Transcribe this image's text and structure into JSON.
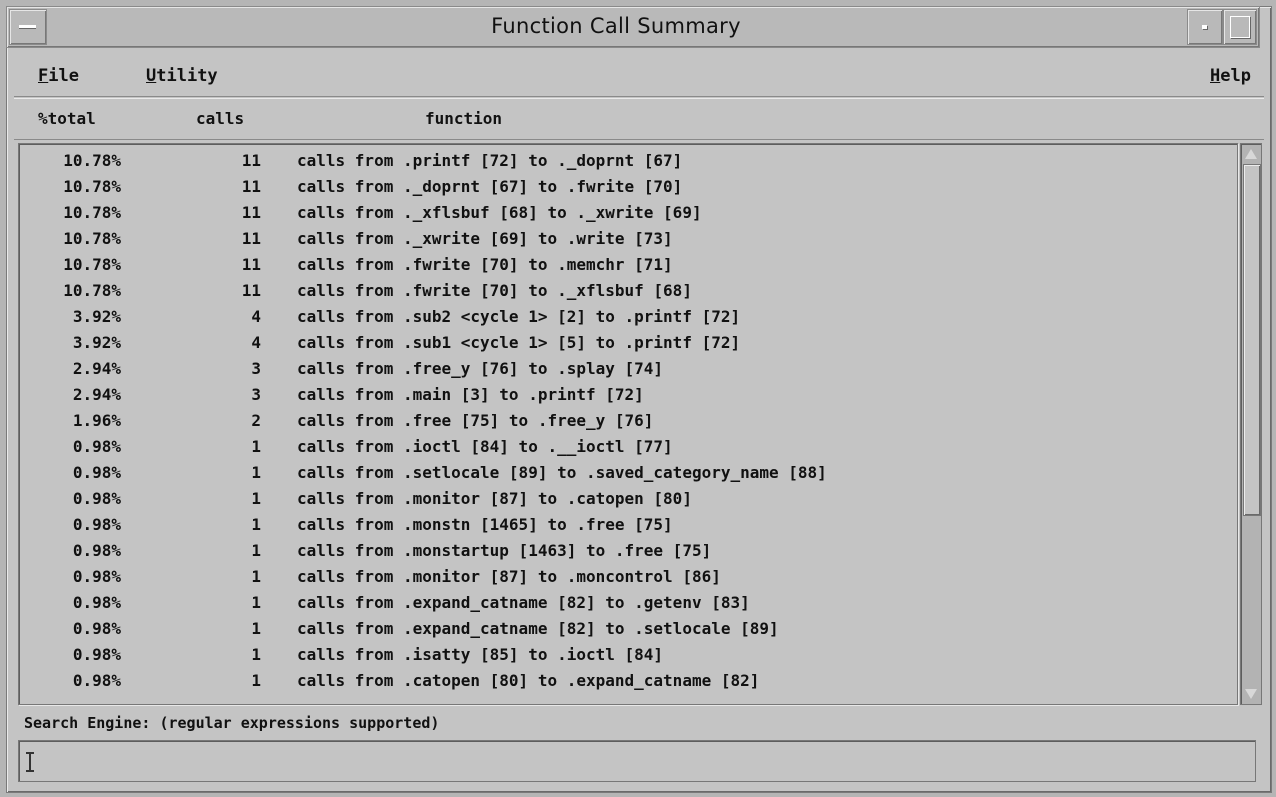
{
  "window": {
    "title": "Function Call Summary"
  },
  "menu": {
    "file": "File",
    "utility": "Utility",
    "help": "Help"
  },
  "columns": {
    "total": "%total",
    "calls": "calls",
    "function": "function"
  },
  "rows": [
    {
      "pct": "10.78%",
      "calls": "11",
      "fn": "calls from .printf [72] to ._doprnt [67]"
    },
    {
      "pct": "10.78%",
      "calls": "11",
      "fn": "calls from ._doprnt [67] to .fwrite [70]"
    },
    {
      "pct": "10.78%",
      "calls": "11",
      "fn": "calls from ._xflsbuf [68] to ._xwrite [69]"
    },
    {
      "pct": "10.78%",
      "calls": "11",
      "fn": "calls from ._xwrite [69] to .write [73]"
    },
    {
      "pct": "10.78%",
      "calls": "11",
      "fn": "calls from .fwrite [70] to .memchr [71]"
    },
    {
      "pct": "10.78%",
      "calls": "11",
      "fn": "calls from .fwrite [70] to ._xflsbuf [68]"
    },
    {
      "pct": "3.92%",
      "calls": "4",
      "fn": "calls from .sub2 <cycle 1> [2] to .printf [72]"
    },
    {
      "pct": "3.92%",
      "calls": "4",
      "fn": "calls from .sub1 <cycle 1> [5] to .printf [72]"
    },
    {
      "pct": "2.94%",
      "calls": "3",
      "fn": "calls from .free_y [76] to .splay [74]"
    },
    {
      "pct": "2.94%",
      "calls": "3",
      "fn": "calls from .main [3] to .printf [72]"
    },
    {
      "pct": "1.96%",
      "calls": "2",
      "fn": "calls from .free [75] to .free_y [76]"
    },
    {
      "pct": "0.98%",
      "calls": "1",
      "fn": "calls from .ioctl [84] to .__ioctl [77]"
    },
    {
      "pct": "0.98%",
      "calls": "1",
      "fn": "calls from .setlocale [89] to .saved_category_name [88]"
    },
    {
      "pct": "0.98%",
      "calls": "1",
      "fn": "calls from .monitor [87] to .catopen [80]"
    },
    {
      "pct": "0.98%",
      "calls": "1",
      "fn": "calls from .monstn [1465] to .free [75]"
    },
    {
      "pct": "0.98%",
      "calls": "1",
      "fn": "calls from .monstartup [1463] to .free [75]"
    },
    {
      "pct": "0.98%",
      "calls": "1",
      "fn": "calls from .monitor [87] to .moncontrol [86]"
    },
    {
      "pct": "0.98%",
      "calls": "1",
      "fn": "calls from .expand_catname [82] to .getenv [83]"
    },
    {
      "pct": "0.98%",
      "calls": "1",
      "fn": "calls from .expand_catname [82] to .setlocale [89]"
    },
    {
      "pct": "0.98%",
      "calls": "1",
      "fn": "calls from .isatty [85] to .ioctl [84]"
    },
    {
      "pct": "0.98%",
      "calls": "1",
      "fn": "calls from .catopen [80] to .expand_catname [82]"
    }
  ],
  "search": {
    "label": "Search Engine: (regular expressions supported)",
    "value": ""
  },
  "icons": {
    "system_menu": "window-menu-icon",
    "minimize": "minimize-icon",
    "maximize": "maximize-icon",
    "scroll_up": "arrow-up-icon",
    "scroll_down": "arrow-down-icon"
  },
  "colors": {
    "background": "#c4c4c4",
    "text": "#111111"
  }
}
